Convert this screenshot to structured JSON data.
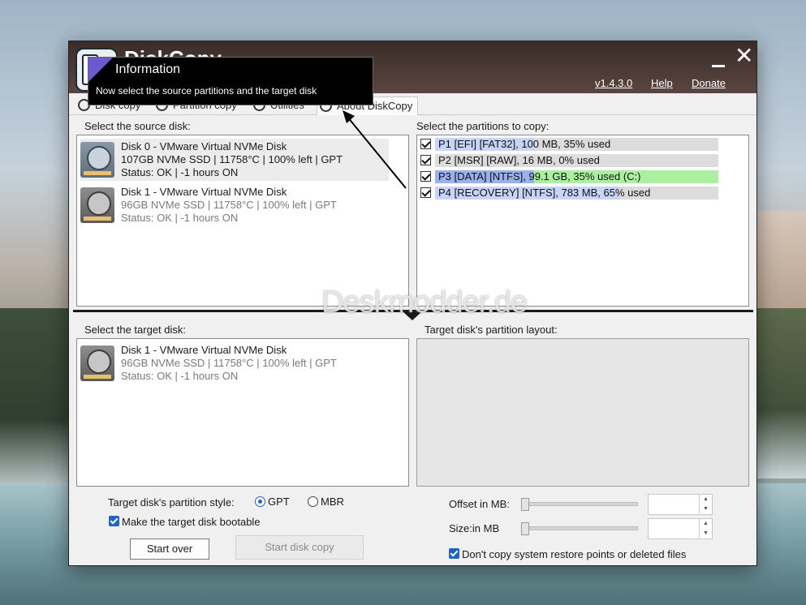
{
  "window": {
    "title": "DiskCopy",
    "version_link": "v1.4.3.0",
    "help_link": "Help",
    "donate_link": "Donate"
  },
  "tabs": [
    {
      "label": "Disk copy",
      "icon": "disk-icon"
    },
    {
      "label": "Partition copy",
      "icon": "partition-icon"
    },
    {
      "label": "Utilities",
      "icon": "tools-icon"
    },
    {
      "label": "About DiskCopy",
      "icon": "info-icon"
    }
  ],
  "source": {
    "label": "Select the source disk:",
    "disks": [
      {
        "title": "Disk 0 - VMware Virtual NVMe Disk",
        "spec": "107GB NVMe SSD | 11758°C | 100% left | GPT",
        "status": "Status: OK | -1 hours ON",
        "selected": true
      },
      {
        "title": "Disk 1 - VMware Virtual NVMe Disk",
        "spec": "96GB NVMe SSD | 11758°C | 100% left | GPT",
        "status": "Status: OK | -1 hours ON",
        "selected": false
      }
    ]
  },
  "partitions": {
    "label": "Select the partitions to copy:",
    "items": [
      {
        "text": "P1 [EFI] [FAT32], 100 MB, 35% used",
        "used_fraction": 0.35,
        "fill": "#c8d4f8",
        "checked": true
      },
      {
        "text": "P2 [MSR] [RAW], 16 MB, 0% used",
        "used_fraction": 0.0,
        "fill": "#c8d4f8",
        "checked": true
      },
      {
        "text": "P3 [DATA] [NTFS], 99.1 GB, 35% used (C:)",
        "used_fraction": 0.35,
        "fill": "#9ab0ef",
        "free_fill": "#aaf0a0",
        "checked": true
      },
      {
        "text": "P4 [RECOVERY] [NTFS], 783 MB, 65% used",
        "used_fraction": 0.65,
        "fill": "#c8d4f8",
        "checked": true
      }
    ]
  },
  "target": {
    "label": "Select the target disk:",
    "disks": [
      {
        "title": "Disk 1 - VMware Virtual NVMe Disk",
        "spec": "96GB NVMe SSD | 11758°C | 100% left | GPT",
        "status": "Status: OK | -1 hours ON"
      }
    ]
  },
  "layout": {
    "label": "Target disk's partition layout:"
  },
  "options": {
    "style_label": "Target disk's partition style:",
    "gpt_label": "GPT",
    "mbr_label": "MBR",
    "selected_style": "GPT",
    "bootable_label": "Make the target disk bootable",
    "bootable_checked": true,
    "offset_label": "Offset in MB:",
    "size_label": "Size:in MB",
    "offset_value": "",
    "size_value": "",
    "no_restore_label": "Don't copy system restore points or deleted files",
    "no_restore_checked": true
  },
  "buttons": {
    "start_over": "Start over",
    "start_copy": "Start disk copy"
  },
  "tooltip": {
    "title": "Information",
    "body": "Now select the source partitions and the target disk"
  },
  "watermark": "Deskmodder.de",
  "colors": {
    "accent": "#1f63c6",
    "titlebar": "#4a3833",
    "partition_used": "#9ab0ef",
    "partition_free": "#aaf0a0"
  }
}
